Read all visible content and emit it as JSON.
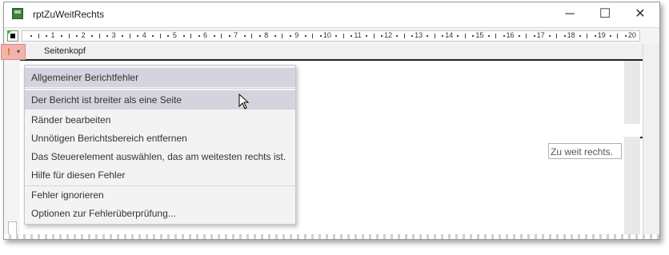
{
  "window": {
    "title": "rptZuWeitRechts",
    "controls": {
      "minimize": "─",
      "maximize": "☐",
      "close": "✕"
    }
  },
  "ruler": {
    "numbers": [
      "1",
      "2",
      "3",
      "4",
      "5",
      "6",
      "7",
      "8",
      "9",
      "10",
      "11",
      "12",
      "13",
      "14",
      "15",
      "16",
      "17",
      "18",
      "19",
      "20"
    ]
  },
  "section": {
    "label": "Seitenkopf"
  },
  "error_button": {
    "icon": "!",
    "dropdown": "▾"
  },
  "textbox": {
    "value": "Zu weit rechts."
  },
  "menu": {
    "header": "Allgemeiner Berichtfehler",
    "selected": "Der Bericht ist breiter als eine Seite",
    "items": [
      "Ränder bearbeiten",
      "Unnötigen Berichtsbereich entfernen",
      "Das Steuerelement auswählen, das am weitesten rechts ist.",
      "Hilfe für diesen Fehler"
    ],
    "items2": [
      "Fehler ignorieren",
      "Optionen zur Fehlerüberprüfung..."
    ]
  }
}
